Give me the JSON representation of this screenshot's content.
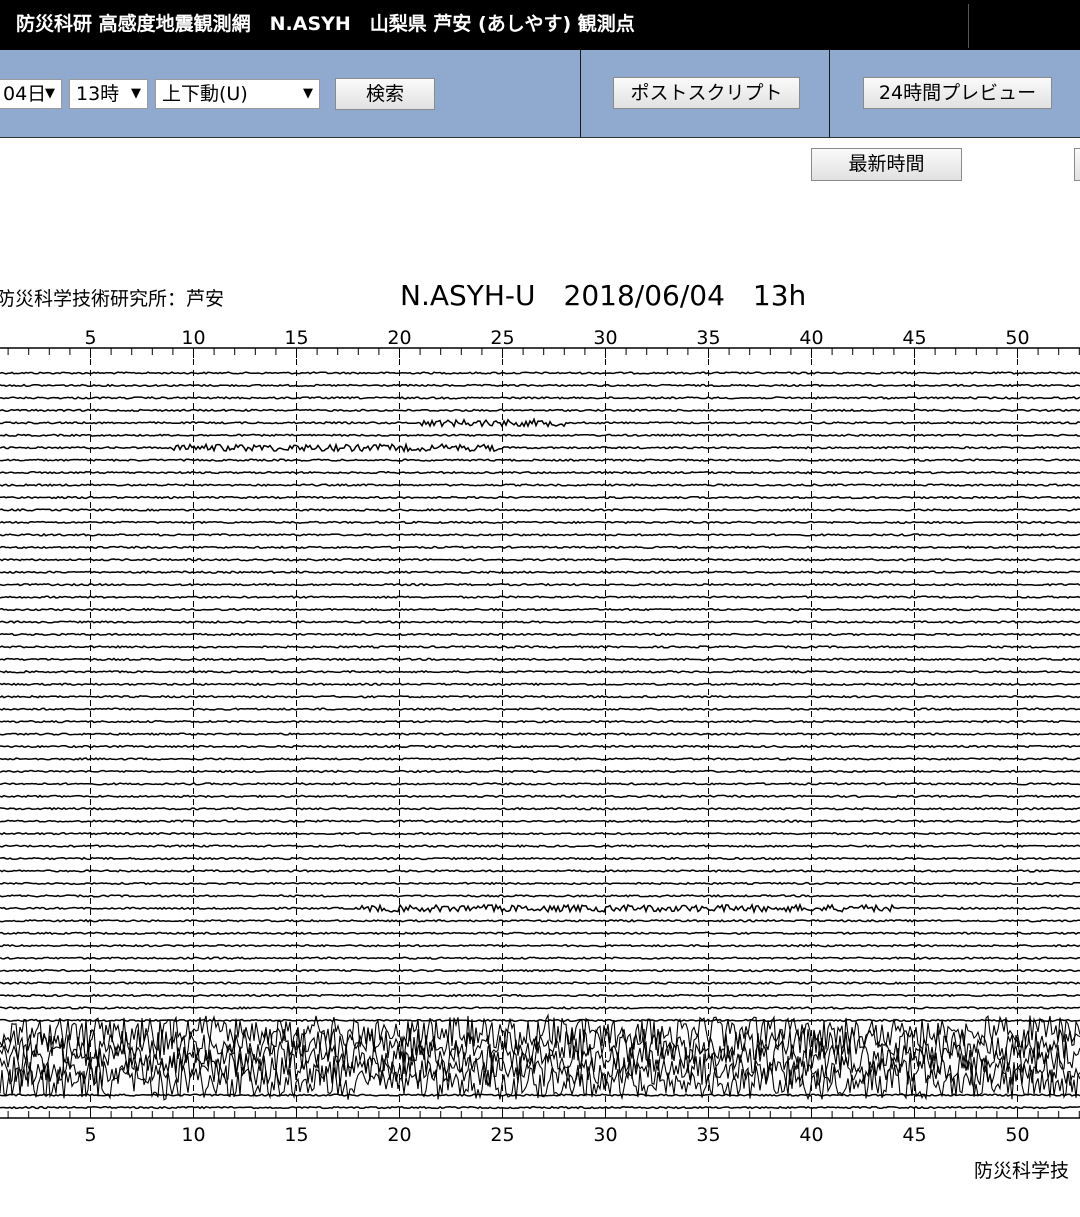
{
  "header": {
    "title": "防災科研 高感度地震観測網　N.ASYH　山梨県 芦安 (あしやす) 観測点"
  },
  "toolbar": {
    "day_select": "04日",
    "hour_select": "13時",
    "component_select": "上下動(U)",
    "search_button": "検索",
    "postscript_button": "ポストスクリプト",
    "preview_button": "24時間プレビュー",
    "latest_button": "最新時間"
  },
  "plot": {
    "institute_label": "防災科学技術研究所：芦安",
    "title": "N.ASYH-U　2018/06/04　13h",
    "footer_label": "防災科学技",
    "axis_ticks": [
      "5",
      "10",
      "15",
      "20",
      "25",
      "30",
      "35",
      "40",
      "45",
      "50"
    ],
    "trace_count": 60,
    "event_traces": [
      {
        "trace": 4,
        "from_min": 21,
        "to_min": 28
      },
      {
        "trace": 6,
        "from_min": 9,
        "to_min": 25
      },
      {
        "trace": 43,
        "from_min": 18,
        "to_min": 44
      }
    ],
    "noisy_trace_range": [
      53,
      57
    ]
  },
  "colors": {
    "titlebar": "#000000",
    "toolbar": "#8fa9cf",
    "trace": "#000000"
  }
}
